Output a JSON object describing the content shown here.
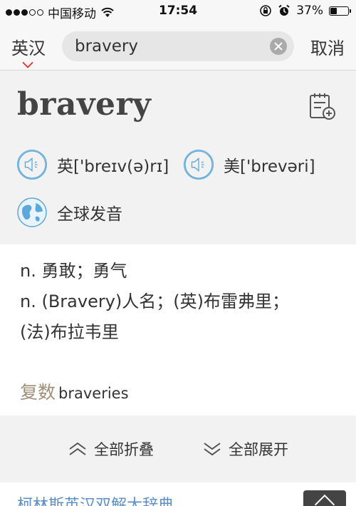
{
  "status": {
    "carrier": "中国移动",
    "time": "17:54",
    "battery_pct": "37%",
    "battery_level": 0.37,
    "signal_bars": 3
  },
  "header": {
    "lang_label": "英汉",
    "search_value": "bravery",
    "cancel_label": "取消"
  },
  "entry": {
    "word": "bravery",
    "uk_pron": "英['breɪv(ə)rɪ]",
    "us_pron": "美['brevəri]",
    "global_pron": "全球发音"
  },
  "definitions": [
    "n. 勇敢；勇气",
    "n. (Bravery)人名；(英)布雷弗里；",
    "(法)布拉韦里"
  ],
  "plural": {
    "label": "复数",
    "value": "braveries"
  },
  "actions": {
    "collapse_all": "全部折叠",
    "expand_all": "全部展开"
  },
  "bottom": {
    "dictionary_title": "柯林斯英汉双解大辞典"
  },
  "colors": {
    "accent_blue": "#5aa8dc",
    "plural_label": "#a08f78",
    "caret_red": "#e03030",
    "link_blue": "#5b8fc9"
  }
}
